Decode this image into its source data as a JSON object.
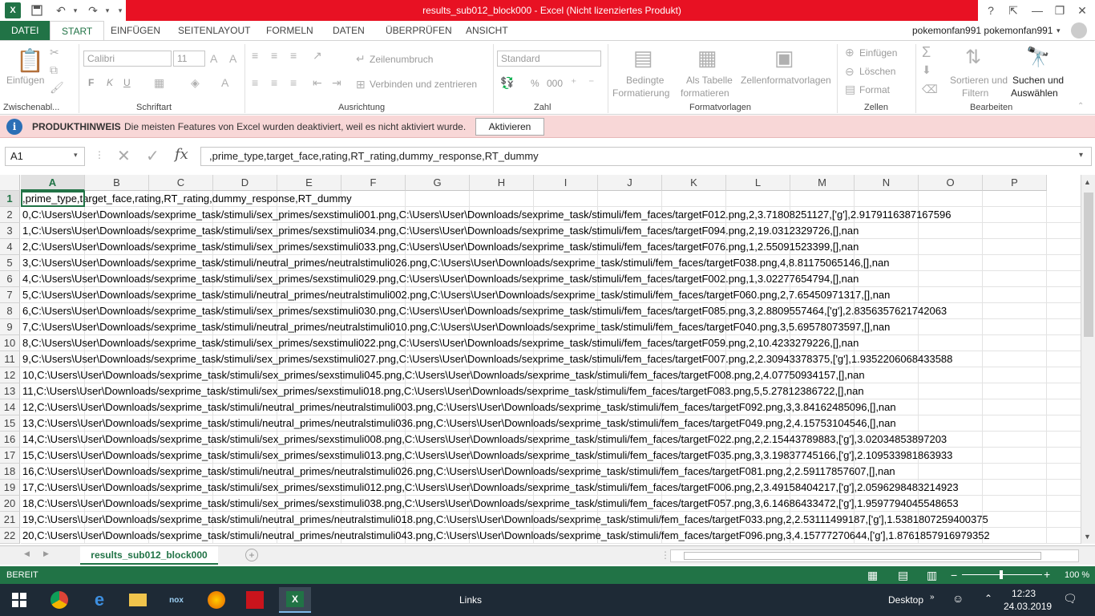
{
  "window": {
    "title": "results_sub012_block000  -  Excel (Nicht lizenziertes Produkt)",
    "help": "?",
    "min": "—",
    "restore": "❐",
    "close": "✕"
  },
  "tabs": [
    "DATEI",
    "START",
    "EINFÜGEN",
    "SEITENLAYOUT",
    "FORMELN",
    "DATEN",
    "ÜBERPRÜFEN",
    "ANSICHT"
  ],
  "user": "pokemonfan991 pokemonfan991",
  "ribbon": {
    "clipboard": {
      "paste": "Einfügen",
      "label": "Zwischenabl..."
    },
    "font": {
      "name": "Calibri",
      "size": "11",
      "bold": "F",
      "italic": "K",
      "underline": "U",
      "label": "Schriftart"
    },
    "alignment": {
      "wrap": "Zeilenumbruch",
      "merge": "Verbinden und zentrieren",
      "label": "Ausrichtung"
    },
    "number": {
      "format": "Standard",
      "percent": "%",
      "thousands": "000",
      "label": "Zahl"
    },
    "styles": {
      "conditional": "Bedingte",
      "conditional2": "Formatierung",
      "table": "Als Tabelle",
      "table2": "formatieren",
      "cell": "Zellenformatvorlagen",
      "label": "Formatvorlagen"
    },
    "cells": {
      "insert": "Einfügen",
      "delete": "Löschen",
      "format": "Format",
      "label": "Zellen"
    },
    "editing": {
      "sort": "Sortieren und",
      "sort2": "Filtern",
      "find": "Suchen und",
      "find2": "Auswählen",
      "label": "Bearbeiten"
    }
  },
  "notice": {
    "label": "PRODUKTHINWEIS",
    "message": "Die meisten Features von Excel wurden deaktiviert, weil es nicht aktiviert wurde.",
    "button": "Aktivieren"
  },
  "formula_bar": {
    "name_box": "A1",
    "fx": "fx",
    "content": ",prime_type,target_face,rating,RT_rating,dummy_response,RT_dummy"
  },
  "columns": [
    "A",
    "B",
    "C",
    "D",
    "E",
    "F",
    "G",
    "H",
    "I",
    "J",
    "K",
    "L",
    "M",
    "N",
    "O",
    "P"
  ],
  "rows": [
    {
      "n": "1",
      "text": ",prime_type,target_face,rating,RT_rating,dummy_response,RT_dummy"
    },
    {
      "n": "2",
      "text": "0,C:\\Users\\User\\Downloads/sexprime_task/stimuli/sex_primes/sexstimuli001.png,C:\\Users\\User\\Downloads/sexprime_task/stimuli/fem_faces/targetF012.png,2,3.71808251127,['g'],2.9179116387167596"
    },
    {
      "n": "3",
      "text": "1,C:\\Users\\User\\Downloads/sexprime_task/stimuli/sex_primes/sexstimuli034.png,C:\\Users\\User\\Downloads/sexprime_task/stimuli/fem_faces/targetF094.png,2,19.0312329726,[],nan"
    },
    {
      "n": "4",
      "text": "2,C:\\Users\\User\\Downloads/sexprime_task/stimuli/sex_primes/sexstimuli033.png,C:\\Users\\User\\Downloads/sexprime_task/stimuli/fem_faces/targetF076.png,1,2.55091523399,[],nan"
    },
    {
      "n": "5",
      "text": "3,C:\\Users\\User\\Downloads/sexprime_task/stimuli/neutral_primes/neutralstimuli026.png,C:\\Users\\User\\Downloads/sexprime_task/stimuli/fem_faces/targetF038.png,4,8.81175065146,[],nan"
    },
    {
      "n": "6",
      "text": "4,C:\\Users\\User\\Downloads/sexprime_task/stimuli/sex_primes/sexstimuli029.png,C:\\Users\\User\\Downloads/sexprime_task/stimuli/fem_faces/targetF002.png,1,3.02277654794,[],nan"
    },
    {
      "n": "7",
      "text": "5,C:\\Users\\User\\Downloads/sexprime_task/stimuli/neutral_primes/neutralstimuli002.png,C:\\Users\\User\\Downloads/sexprime_task/stimuli/fem_faces/targetF060.png,2,7.65450971317,[],nan"
    },
    {
      "n": "8",
      "text": "6,C:\\Users\\User\\Downloads/sexprime_task/stimuli/sex_primes/sexstimuli030.png,C:\\Users\\User\\Downloads/sexprime_task/stimuli/fem_faces/targetF085.png,3,2.8809557464,['g'],2.8356357621742063"
    },
    {
      "n": "9",
      "text": "7,C:\\Users\\User\\Downloads/sexprime_task/stimuli/neutral_primes/neutralstimuli010.png,C:\\Users\\User\\Downloads/sexprime_task/stimuli/fem_faces/targetF040.png,3,5.69578073597,[],nan"
    },
    {
      "n": "10",
      "text": "8,C:\\Users\\User\\Downloads/sexprime_task/stimuli/sex_primes/sexstimuli022.png,C:\\Users\\User\\Downloads/sexprime_task/stimuli/fem_faces/targetF059.png,2,10.4233279226,[],nan"
    },
    {
      "n": "11",
      "text": "9,C:\\Users\\User\\Downloads/sexprime_task/stimuli/sex_primes/sexstimuli027.png,C:\\Users\\User\\Downloads/sexprime_task/stimuli/fem_faces/targetF007.png,2,2.30943378375,['g'],1.9352206068433588"
    },
    {
      "n": "12",
      "text": "10,C:\\Users\\User\\Downloads/sexprime_task/stimuli/sex_primes/sexstimuli045.png,C:\\Users\\User\\Downloads/sexprime_task/stimuli/fem_faces/targetF008.png,2,4.07750934157,[],nan"
    },
    {
      "n": "13",
      "text": "11,C:\\Users\\User\\Downloads/sexprime_task/stimuli/sex_primes/sexstimuli018.png,C:\\Users\\User\\Downloads/sexprime_task/stimuli/fem_faces/targetF083.png,5,5.27812386722,[],nan"
    },
    {
      "n": "14",
      "text": "12,C:\\Users\\User\\Downloads/sexprime_task/stimuli/neutral_primes/neutralstimuli003.png,C:\\Users\\User\\Downloads/sexprime_task/stimuli/fem_faces/targetF092.png,3,3.84162485096,[],nan"
    },
    {
      "n": "15",
      "text": "13,C:\\Users\\User\\Downloads/sexprime_task/stimuli/neutral_primes/neutralstimuli036.png,C:\\Users\\User\\Downloads/sexprime_task/stimuli/fem_faces/targetF049.png,2,4.15753104546,[],nan"
    },
    {
      "n": "16",
      "text": "14,C:\\Users\\User\\Downloads/sexprime_task/stimuli/sex_primes/sexstimuli008.png,C:\\Users\\User\\Downloads/sexprime_task/stimuli/fem_faces/targetF022.png,2,2.15443789883,['g'],3.02034853897203"
    },
    {
      "n": "17",
      "text": "15,C:\\Users\\User\\Downloads/sexprime_task/stimuli/sex_primes/sexstimuli013.png,C:\\Users\\User\\Downloads/sexprime_task/stimuli/fem_faces/targetF035.png,3,3.19837745166,['g'],2.109533981863933"
    },
    {
      "n": "18",
      "text": "16,C:\\Users\\User\\Downloads/sexprime_task/stimuli/neutral_primes/neutralstimuli026.png,C:\\Users\\User\\Downloads/sexprime_task/stimuli/fem_faces/targetF081.png,2,2.59117857607,[],nan"
    },
    {
      "n": "19",
      "text": "17,C:\\Users\\User\\Downloads/sexprime_task/stimuli/sex_primes/sexstimuli012.png,C:\\Users\\User\\Downloads/sexprime_task/stimuli/fem_faces/targetF006.png,2,3.49158404217,['g'],2.0596298483214923"
    },
    {
      "n": "20",
      "text": "18,C:\\Users\\User\\Downloads/sexprime_task/stimuli/sex_primes/sexstimuli038.png,C:\\Users\\User\\Downloads/sexprime_task/stimuli/fem_faces/targetF057.png,3,6.14686433472,['g'],1.9597794045548653"
    },
    {
      "n": "21",
      "text": "19,C:\\Users\\User\\Downloads/sexprime_task/stimuli/neutral_primes/neutralstimuli018.png,C:\\Users\\User\\Downloads/sexprime_task/stimuli/fem_faces/targetF033.png,2,2.53111499187,['g'],1.5381807259400375"
    },
    {
      "n": "22",
      "text": "20,C:\\Users\\User\\Downloads/sexprime_task/stimuli/neutral_primes/neutralstimuli043.png,C:\\Users\\User\\Downloads/sexprime_task/stimuli/fem_faces/targetF096.png,3,4.15777270644,['g'],1.8761857916979352"
    }
  ],
  "sheet": {
    "tab": "results_sub012_block000",
    "add": "+"
  },
  "status": {
    "ready": "BEREIT",
    "zoom": "100 %",
    "minus": "−",
    "plus": "+"
  },
  "taskbar": {
    "links": "Links",
    "desktop": "Desktop",
    "time": "12:23",
    "date": "24.03.2019"
  },
  "colors": {
    "excel_green": "#217346",
    "title_red": "#e81123",
    "notice_bg": "#f8d7d7",
    "taskbar": "#1e2a36"
  }
}
